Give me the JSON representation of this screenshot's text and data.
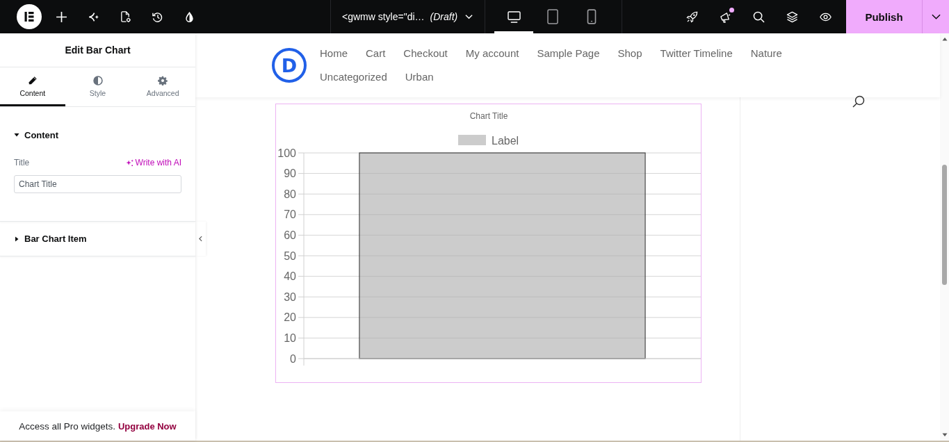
{
  "top_bar": {
    "document": {
      "title": "<gwmw style=\"di…",
      "status": "(Draft)"
    },
    "devices": [
      {
        "selected": true
      },
      {
        "selected": false
      },
      {
        "selected": false
      }
    ],
    "notification_dot": true,
    "publish": "Publish"
  },
  "panel": {
    "title": "Edit Bar Chart",
    "tabs": [
      {
        "label": "Content",
        "selected": true
      },
      {
        "label": "Style",
        "selected": false
      },
      {
        "label": "Advanced",
        "selected": false
      }
    ],
    "sections": [
      {
        "title": "Content",
        "expanded": true,
        "fields": [
          {
            "label": "Title",
            "ai_link": "Write with AI",
            "value": "Chart Title"
          }
        ]
      },
      {
        "title": "Bar Chart Item",
        "expanded": false
      }
    ],
    "footer": {
      "text": "Access all Pro widgets.",
      "link": "Upgrade Now"
    }
  },
  "site": {
    "logo": "D",
    "nav_rows": [
      [
        "Home",
        "Cart",
        "Checkout",
        "My account",
        "Sample Page",
        "Shop",
        "Twitter Timeline",
        "Nature"
      ],
      [
        "Uncategorized",
        "Urban"
      ]
    ]
  },
  "chart_widget": {
    "chart_data": {
      "type": "bar",
      "title": "Chart Title",
      "series": [
        {
          "name": "Label",
          "color": "#cccccc",
          "values": [
            100
          ]
        }
      ],
      "ylim": [
        0,
        100
      ],
      "yticks": [
        0,
        10,
        20,
        30,
        40,
        50,
        60,
        70,
        80,
        90,
        100
      ],
      "grid": true
    }
  }
}
